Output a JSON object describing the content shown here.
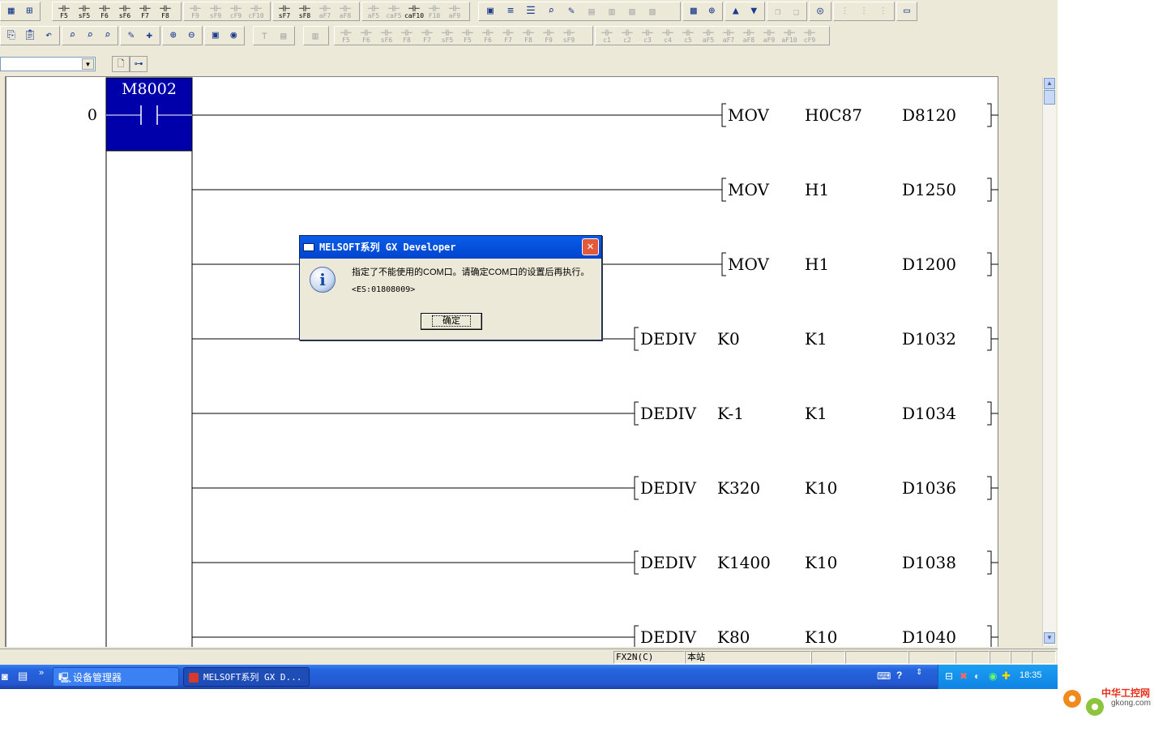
{
  "toolbar1": {
    "group_a": [
      "",
      ""
    ],
    "group_b": [
      "F5",
      "sF5",
      "F6",
      "sF6",
      "F7",
      "F8"
    ],
    "group_c": [
      "F9",
      "sF9",
      "cF9",
      "cF10"
    ],
    "group_d": [
      "sF7",
      "sF8",
      "aF7",
      "aF8"
    ],
    "group_e": [
      "aF5",
      "caF5",
      "caF10",
      "F10",
      "aF9"
    ]
  },
  "toolbar2": {
    "fkeys_a": [
      "F5",
      "F6",
      "sF6",
      "F8",
      "F7",
      "sF5",
      "F5",
      "F6",
      "F7",
      "F8",
      "F9",
      "sF9"
    ],
    "fkeys_b": [
      "c1",
      "c2",
      "c3",
      "c4",
      "c5",
      "aF5",
      "aF7",
      "aF8",
      "aF9",
      "aF10",
      "cF9"
    ]
  },
  "ladder": {
    "step_number": "0",
    "contact_label": "M8002",
    "instructions": [
      {
        "op": "MOV",
        "a": "H0C87",
        "b": "D8120"
      },
      {
        "op": "MOV",
        "a": "H1",
        "b": "D1250"
      },
      {
        "op": "MOV",
        "a": "H1",
        "b": "D1200"
      },
      {
        "op": "DEDIV",
        "s1": "K0",
        "s2": "K1",
        "d": "D1032"
      },
      {
        "op": "DEDIV",
        "s1": "K-1",
        "s2": "K1",
        "d": "D1034"
      },
      {
        "op": "DEDIV",
        "s1": "K320",
        "s2": "K10",
        "d": "D1036"
      },
      {
        "op": "DEDIV",
        "s1": "K1400",
        "s2": "K10",
        "d": "D1038"
      },
      {
        "op": "DEDIV",
        "s1": "K80",
        "s2": "K10",
        "d": "D1040"
      }
    ]
  },
  "statusbar": {
    "cpu": "FX2N(C)",
    "station": "本站"
  },
  "taskbar": {
    "buttons": [
      {
        "label": "设备管理器"
      },
      {
        "label": "MELSOFT系列 GX D..."
      }
    ],
    "clock": "18:35"
  },
  "dialog": {
    "title": "MELSOFT系列 GX Developer",
    "message": "指定了不能使用的COM口。请确定COM口的设置后再执行。",
    "code": "<ES:01808009>",
    "ok_label": "确定"
  },
  "watermark": {
    "line1": "中华工控网",
    "line2": "gkong.com"
  },
  "colors": {
    "selection": "#0000aa",
    "dialog_title": "#0a5de8",
    "taskbar": "#2457d0"
  }
}
